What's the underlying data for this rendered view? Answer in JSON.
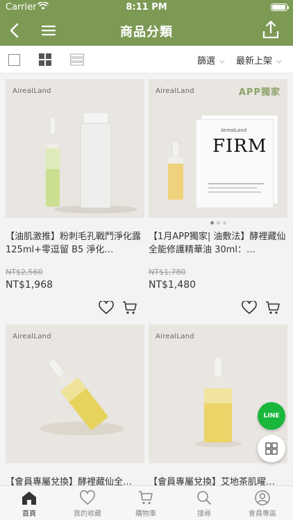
{
  "status": {
    "carrier": "Carrier",
    "time": "8:11 PM"
  },
  "header": {
    "title": "商品分類"
  },
  "filter": {
    "filter_label": "篩選",
    "sort_label": "最新上架"
  },
  "products": [
    {
      "brand": "AirealLand",
      "name": "【油肌激推】粉刺毛孔戰鬥淨化露 125ml+零逗留 B5 淨化…",
      "old_price": "NT$2,560",
      "price": "NT$1,968"
    },
    {
      "brand": "AirealLand",
      "badge": "APP獨家",
      "pack_brand": "AirealLand",
      "pack_title": "FIRM",
      "name": "【1月APP獨家| 油敷法】酵裡藏仙全能修護精華油 30ml：…",
      "old_price": "NT$1,780",
      "price": "NT$1,480"
    },
    {
      "brand": "AirealLand",
      "name": "【會員專屬兌換】酵裡藏仙全…"
    },
    {
      "brand": "AirealLand",
      "name": "【會員專屬兌換】艾地茶肌曜…"
    }
  ],
  "line_button": {
    "label": "LINE"
  },
  "tabbar": {
    "items": [
      {
        "label": "首頁",
        "icon": "home-icon"
      },
      {
        "label": "我的收藏",
        "icon": "heart-icon"
      },
      {
        "label": "購物車",
        "icon": "cart-icon"
      },
      {
        "label": "搜尋",
        "icon": "search-icon"
      },
      {
        "label": "會員專區",
        "icon": "user-icon"
      }
    ]
  },
  "colors": {
    "brand_green": "#7d9a55",
    "line_green": "#19b73c"
  }
}
